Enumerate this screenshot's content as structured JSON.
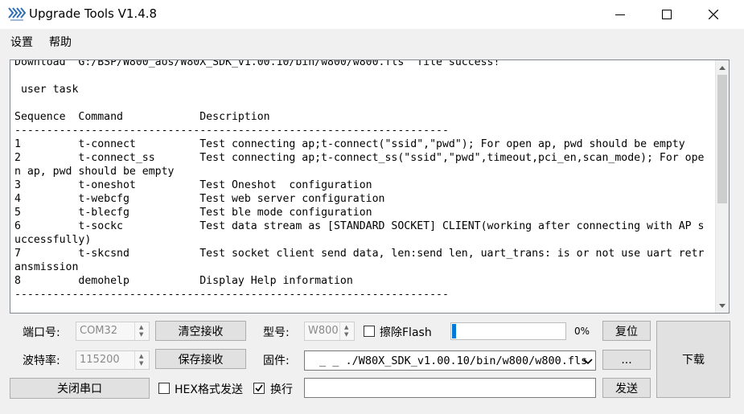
{
  "window": {
    "title": "Upgrade Tools V1.4.8",
    "minimize_icon": "minimize-icon",
    "maximize_icon": "maximize-icon",
    "close_icon": "close-icon"
  },
  "menu": {
    "items": [
      "设置",
      "帮助"
    ]
  },
  "console": {
    "text": "Download  G:/BSP/W800_aos/W80X_SDK_v1.00.10/bin/w800/w800.fls  file success!\n\n user task\n\nSequence  Command            Description\n--------------------------------------------------------------------\n1         t-connect          Test connecting ap;t-connect(\"ssid\",\"pwd\"); For open ap, pwd should be empty\n2         t-connect_ss       Test connecting ap;t-connect_ss(\"ssid\",\"pwd\",timeout,pci_en,scan_mode); For open ap, pwd should be empty\n3         t-oneshot          Test Oneshot  configuration\n4         t-webcfg           Test web server configuration\n5         t-blecfg           Test ble mode configuration\n6         t-sockc            Test data stream as [STANDARD SOCKET] CLIENT(working after connecting with AP successfully)\n7         t-skcsnd           Test socket client send data, len:send len, uart_trans: is or not use uart retransmission\n8         demohelp           Display Help information\n--------------------------------------------------------------------"
  },
  "serial": {
    "port_label": "端口号:",
    "port_value": "COM32",
    "baud_label": "波特率:",
    "baud_value": "115200",
    "close_port_button": "关闭串口",
    "clear_button": "清空接收",
    "save_button": "保存接收",
    "hex_send_label": "HEX格式发送",
    "hex_send_checked": false,
    "newline_label": "换行",
    "newline_checked": true
  },
  "firmware": {
    "model_label": "型号:",
    "model_value": "W800",
    "erase_flash_label": "擦除Flash",
    "erase_flash_checked": false,
    "progress_percent": 2,
    "progress_text": "0%",
    "reset_button": "复位",
    "file_label": "固件:",
    "file_value": "_  _  ./W80X_SDK_v1.00.10/bin/w800/w800.fls",
    "browse_button": "...",
    "download_button": "下载",
    "send_input_value": "",
    "send_button": "发送"
  },
  "colors": {
    "progress_fill": "#0078d7",
    "button_face": "#e1e1e1"
  }
}
